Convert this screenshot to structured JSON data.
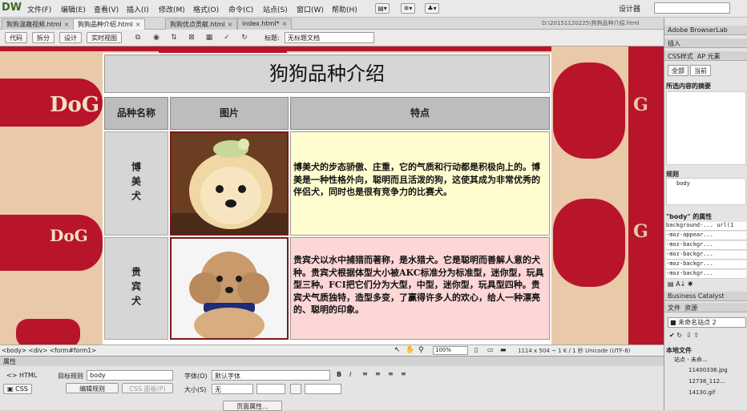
{
  "app": {
    "logo": "DW",
    "designer": "设计器"
  },
  "menu": [
    "文件(F)",
    "编辑(E)",
    "查看(V)",
    "插入(I)",
    "修改(M)",
    "格式(O)",
    "命令(C)",
    "站点(S)",
    "窗口(W)",
    "帮助(H)"
  ],
  "tabs": [
    {
      "label": "狗狗温趣视频.html",
      "active": false
    },
    {
      "label": "狗狗品种介绍.html",
      "active": true
    },
    {
      "label": "狗狗优点贡献.html",
      "active": false
    },
    {
      "label": "index.html*",
      "active": false
    }
  ],
  "file_path": "D:\\20151120225\\狗狗品种介绍.html",
  "toolbar": {
    "code": "代码",
    "split": "拆分",
    "design": "设计",
    "live": "实时视图",
    "title_label": "标题:",
    "title_value": "无标题文档"
  },
  "page": {
    "title": "狗狗品种介绍",
    "headers": [
      "品种名称",
      "图片",
      "特点"
    ],
    "rows": [
      {
        "name": "博美犬",
        "image": "pomeranian",
        "desc": "博美犬的步态骄傲、庄重，它的气质和行动都是积极向上的。博美是一种性格外向，聪明而且活泼的狗，这使其成为非常优秀的伴侣犬，同时也是很有竞争力的比赛犬。"
      },
      {
        "name": "贵宾犬",
        "image": "poodle",
        "desc": "贵宾犬以水中捕猎而著称，是水猎犬。它是聪明而善解人意的犬种。贵宾犬根据体型大小被AKC标准分为标准型，迷你型，玩具型三种。FCI把它们分为大型，中型，迷你型，玩具型四种。贵宾犬气质独特，造型多变，了赢得许多人的欢心，给人一种漂亮的、聪明的印象。"
      }
    ],
    "bg_word": "DoG"
  },
  "status": {
    "tagpath": "<body> <div> <form#form1>",
    "zoom": "100%",
    "dims": "1114 x 504 ~ 1 K / 1 秒  Unicode (UTF-8)"
  },
  "props": {
    "title": "属性",
    "html": "HTML",
    "css": "CSS",
    "target_rule_label": "目标规则",
    "target_rule": "body",
    "edit_rule": "编辑规则",
    "css_panel": "CSS 面板(P)",
    "font_label": "字体(O)",
    "font_value": "默认字体",
    "size_label": "大小(S)",
    "size_value": "无",
    "page_props": "页面属性..."
  },
  "right": {
    "browserlab": "Adobe BrowserLab",
    "insert": "插入",
    "css_styles": "CSS样式",
    "ap": "AP 元素",
    "all": "全部",
    "current": "当前",
    "summary": "所选内容的摘要",
    "rules": "规则",
    "rule_body": "body",
    "body_props": "\"body\" 的属性",
    "prop_rows": [
      "background-... url(1",
      "-moz-appear...",
      "-moz-backgr...",
      "-moz-backgr...",
      "-moz-backgr...",
      "-moz-backgr...",
      "-moz-backgr..."
    ],
    "bc": "Business Catalyst",
    "files": "文件",
    "assets": "资源",
    "site": "未命名站点 2",
    "local_files": "本地文件",
    "file_items": [
      "站点 - 未命...",
      "11400336.jpg",
      "12738_112...",
      "14130.gif"
    ]
  },
  "colors": {
    "brand_red": "#b8152a",
    "tan": "#e9c9a8",
    "cell_yellow": "#fffdd0",
    "cell_pink": "#fdd6d6"
  }
}
